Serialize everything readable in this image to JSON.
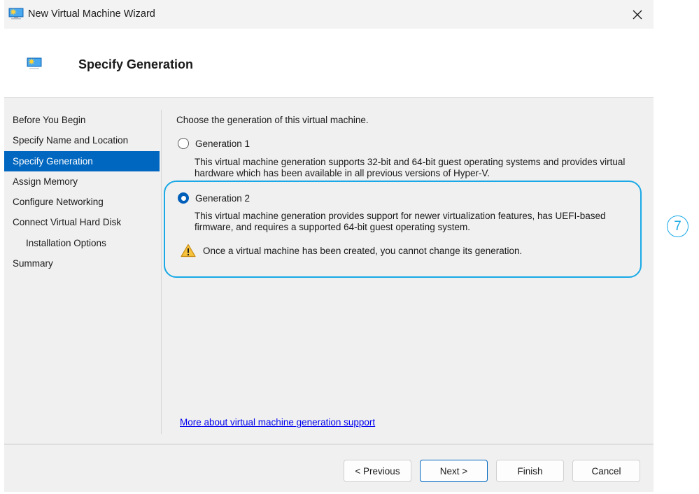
{
  "window": {
    "title": "New Virtual Machine Wizard",
    "app_icon": "virtual-machine-icon",
    "close_icon": "close-icon"
  },
  "header": {
    "icon": "virtual-machine-icon",
    "title": "Specify Generation"
  },
  "nav": {
    "items": [
      {
        "label": "Before You Begin",
        "active": false,
        "indent": false
      },
      {
        "label": "Specify Name and Location",
        "active": false,
        "indent": false
      },
      {
        "label": "Specify Generation",
        "active": true,
        "indent": false
      },
      {
        "label": "Assign Memory",
        "active": false,
        "indent": false
      },
      {
        "label": "Configure Networking",
        "active": false,
        "indent": false
      },
      {
        "label": "Connect Virtual Hard Disk",
        "active": false,
        "indent": false
      },
      {
        "label": "Installation Options",
        "active": false,
        "indent": true
      },
      {
        "label": "Summary",
        "active": false,
        "indent": false
      }
    ]
  },
  "content": {
    "intro": "Choose the generation of this virtual machine.",
    "options": [
      {
        "label": "Generation 1",
        "selected": false,
        "description": "This virtual machine generation supports 32-bit and 64-bit guest operating systems and provides virtual hardware which has been available in all previous versions of Hyper-V."
      },
      {
        "label": "Generation 2",
        "selected": true,
        "description": "This virtual machine generation provides support for newer virtualization features, has UEFI-based firmware, and requires a supported 64-bit guest operating system."
      }
    ],
    "warning": {
      "icon": "warning-icon",
      "text": "Once a virtual machine has been created, you cannot change its generation."
    },
    "link": "More about virtual machine generation support"
  },
  "callout": {
    "number": "7",
    "color": "#19a9e6"
  },
  "buttons": {
    "previous": "< Previous",
    "next": "Next >",
    "finish": "Finish",
    "cancel": "Cancel"
  },
  "colors": {
    "accent": "#0067c0",
    "highlight": "#19a9e6",
    "link": "#0000ee"
  }
}
